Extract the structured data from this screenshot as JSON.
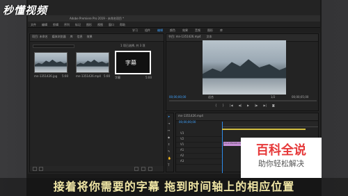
{
  "watermark": {
    "logo_text": "秒懂视频"
  },
  "window": {
    "title": "Adobe Premiere Pro 2019 - 未命名项目 *"
  },
  "menu": [
    "文件",
    "编辑",
    "剪辑",
    "序列",
    "标记",
    "图形",
    "视图",
    "窗口",
    "帮助"
  ],
  "workspaces": [
    "学习",
    "组件",
    "编辑",
    "颜色",
    "效果",
    "音频",
    "图形",
    "库"
  ],
  "project_panel": {
    "tabs": [
      "项目: 未命名",
      "媒体浏览器",
      "库",
      "信息",
      "效果"
    ],
    "search_placeholder": "",
    "count_label": "1 项已选择, 共 3 项",
    "items": [
      {
        "name": "mn-1351426.jpg",
        "duration": "5:00"
      },
      {
        "name": "mn-1351426.mp4",
        "duration": "5:00"
      },
      {
        "name": "字幕",
        "duration": "5:00"
      }
    ]
  },
  "source_panel": {
    "tabs": [
      "节目: mn-1351426.mp4",
      "文本"
    ],
    "timecode_left": "00;00;00;00",
    "fit": "适合",
    "ratio": "1/2",
    "timecode_right": "00;00;05;00"
  },
  "timeline": {
    "tab": "mn-1351426.mp4",
    "timecode": "00;00;00;00",
    "tracks": [
      "V3",
      "V2",
      "V1",
      "A1",
      "A2",
      "A3"
    ],
    "clip_label": "mn-1351426.mp4"
  },
  "baike": {
    "title": "百科全说",
    "subtitle": "助你轻松解决"
  },
  "caption": "接着将你需要的字幕 拖到时间轴上的相应位置",
  "colors": {
    "accent": "#2d8ceb",
    "caption": "#f1e7a6",
    "baike_red": "#e6393a",
    "clip_pink": "#c78fd6"
  }
}
